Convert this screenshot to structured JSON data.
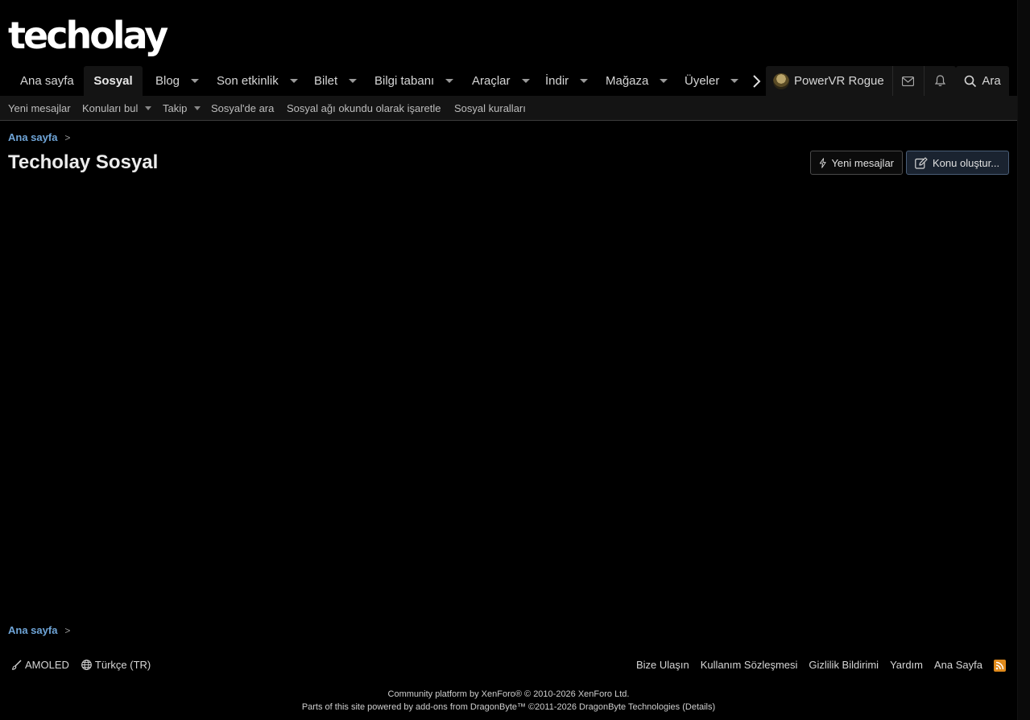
{
  "site": {
    "logo": "techolay"
  },
  "nav": {
    "tabs": [
      {
        "label": "Ana sayfa"
      },
      {
        "label": "Sosyal"
      },
      {
        "label": "Blog"
      },
      {
        "label": "Son etkinlik"
      },
      {
        "label": "Bilet"
      },
      {
        "label": "Bilgi tabanı"
      },
      {
        "label": "Araçlar"
      },
      {
        "label": "İndir"
      },
      {
        "label": "Mağaza"
      },
      {
        "label": "Üyeler"
      }
    ],
    "active_tab": "Sosyal",
    "user_name": "PowerVR Rogue",
    "search_label": "Ara"
  },
  "subnav": {
    "items": [
      {
        "label": "Yeni mesajlar"
      },
      {
        "label": "Konuları bul"
      },
      {
        "label": "Takip"
      },
      {
        "label": "Sosyal'de ara"
      },
      {
        "label": "Sosyal ağı okundu olarak işaretle"
      },
      {
        "label": "Sosyal kuralları"
      }
    ]
  },
  "breadcrumb": {
    "home": "Ana sayfa"
  },
  "page": {
    "title": "Techolay Sosyal",
    "new_posts_button": "Yeni mesajlar",
    "create_thread_button": "Konu oluştur..."
  },
  "footer": {
    "style": "AMOLED",
    "language": "Türkçe (TR)",
    "links": [
      "Bize Ulaşın",
      "Kullanım Sözleşmesi",
      "Gizlilik Bildirimi",
      "Yardım",
      "Ana Sayfa"
    ],
    "copyright_line1": "Community platform by XenForo® © 2010-2026 XenForo Ltd.",
    "copyright_line2": "Parts of this site powered by add-ons from DragonByte™ ©2011-2026 DragonByte Technologies (Details)"
  },
  "colors": {
    "background": "#000000",
    "link": "#6fa5d8",
    "accent_rss": "#e08a1b"
  }
}
